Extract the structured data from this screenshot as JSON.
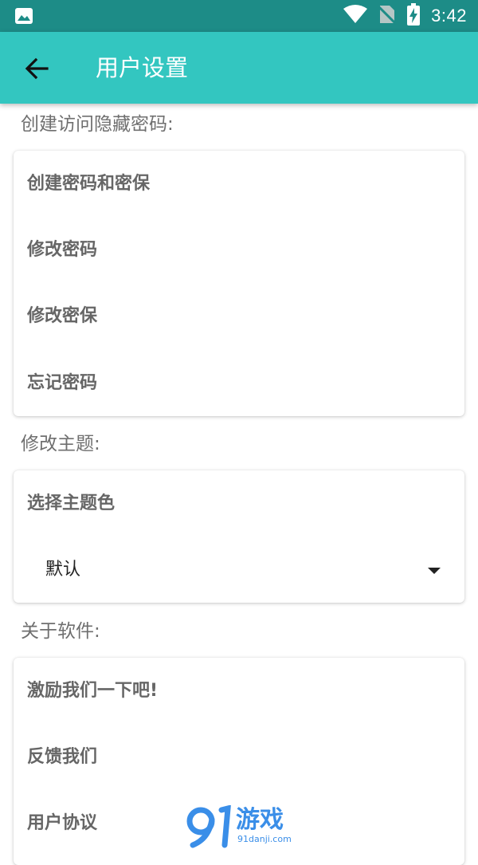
{
  "status_bar": {
    "time": "3:42",
    "icons": [
      "image-icon",
      "wifi-icon",
      "no-sim-icon",
      "battery-charging-icon"
    ]
  },
  "app_bar": {
    "title": "用户设置",
    "back_icon": "arrow-left-icon",
    "color": "#33c6c0"
  },
  "sections": {
    "password": {
      "label": "创建访问隐藏密码:",
      "items": [
        "创建密码和密保",
        "修改密码",
        "修改密保",
        "忘记密码"
      ]
    },
    "theme": {
      "label": "修改主题:",
      "item": "选择主题色",
      "dropdown_value": "默认"
    },
    "about": {
      "label": "关于软件:",
      "items": [
        "激励我们一下吧!",
        "反馈我们",
        "用户协议"
      ]
    }
  },
  "watermark": {
    "logo_text": "游戏",
    "sub_text": "91danji.com"
  }
}
